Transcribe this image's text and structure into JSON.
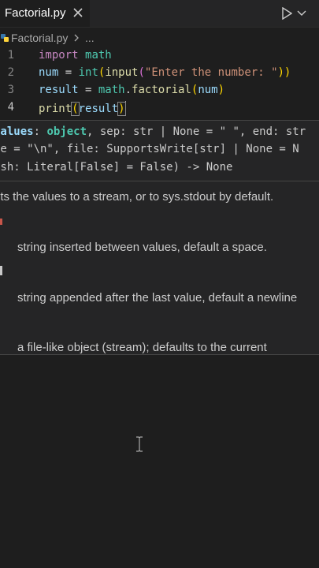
{
  "tab": {
    "label": "Factorial.py"
  },
  "breadcrumb": {
    "file": "Factorial.py",
    "more": "..."
  },
  "editor": {
    "line_numbers": [
      "1",
      "2",
      "3",
      "4"
    ],
    "line1": {
      "kw": "import",
      "mod": "math"
    },
    "line2": {
      "var": "num",
      "eq": " = ",
      "fn1": "int",
      "p1": "(",
      "fn2": "input",
      "p2": "(",
      "str": "\"Enter the number: \"",
      "p3": "))"
    },
    "line3": {
      "var": "result",
      "eq": " = ",
      "mod": "math",
      "dot": ".",
      "fn": "factorial",
      "p1": "(",
      "arg": "num",
      "p2": ")"
    },
    "line4": {
      "fn": "print",
      "p1": "(",
      "arg": "result",
      "p2": ")"
    }
  },
  "hover": {
    "sig1": {
      "p": "values",
      "c1": ": ",
      "t": "object",
      "rest": ", sep: str | None = \" \", end: str"
    },
    "sig2": "ne = \"\\n\", file: SupportsWrite[str] | None = N",
    "sig3": "ush: Literal[False] = False) -> None",
    "doc_main": "nts the values to a stream, or to sys.stdout by default.",
    "doc_sep": "string inserted between values, default a space.",
    "doc_end": "string appended after the last value, default a newline",
    "doc_file": "a file-like object (stream); defaults to the current"
  },
  "colors": {
    "background": "#1e1e1e",
    "keyword": "#c586c0",
    "function": "#dcdcaa",
    "variable": "#9cdcfe",
    "string": "#ce9178",
    "type": "#4ec9b0"
  },
  "icons": [
    "close-icon",
    "run-icon",
    "chevron-down-icon",
    "python-file-icon",
    "chevron-right-icon",
    "text-cursor-icon"
  ]
}
